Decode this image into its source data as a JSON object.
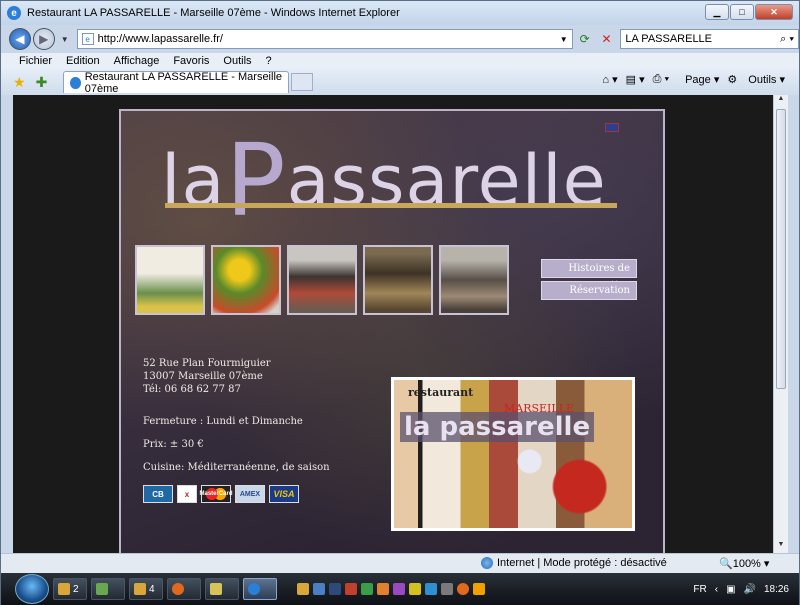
{
  "window": {
    "title": "Restaurant LA PASSARELLE - Marseille 07ème - Windows Internet Explorer"
  },
  "address": {
    "url": "http://www.lapassarelle.fr/",
    "search_value": "LA PASSARELLE"
  },
  "menu": [
    "Fichier",
    "Edition",
    "Affichage",
    "Favoris",
    "Outils",
    "?"
  ],
  "tabs": [
    {
      "label": "Restaurant LA PASSARELLE - Marseille 07ème"
    }
  ],
  "command_bar": {
    "page_label": "Page",
    "tools_label": "Outils"
  },
  "site": {
    "logo": {
      "small": "la",
      "big": "P",
      "rest": "assarelle"
    },
    "nav_buttons": [
      "Histoires de recettes",
      "Réservation"
    ],
    "address_lines": [
      "52 Rue Plan Fourmiguier",
      "13007 Marseille 07ème",
      "Tél: 06 68 62 77 87"
    ],
    "closing": "Fermeture : Lundi et Dimanche",
    "price": "Prix: ± 30 €",
    "cuisine": "Cuisine: Méditerranéenne, de saison",
    "cards": [
      "CB",
      "x",
      "MasterCard",
      "AMEX",
      "VISA"
    ],
    "poster": {
      "top": "restaurant",
      "city": "MARSEILLE",
      "name": "la passarelle"
    }
  },
  "status": {
    "zone": "Internet | Mode protégé : désactivé",
    "zoom": "100%"
  },
  "taskbar": {
    "items": [
      "2",
      "",
      "4",
      "",
      "",
      ""
    ],
    "lang": "FR",
    "clock": "18:26"
  },
  "colors": {
    "logo_gold_line": "#c9a65a",
    "nav_button_bg": "#b7aecb",
    "site_bg": "#3a3040"
  }
}
